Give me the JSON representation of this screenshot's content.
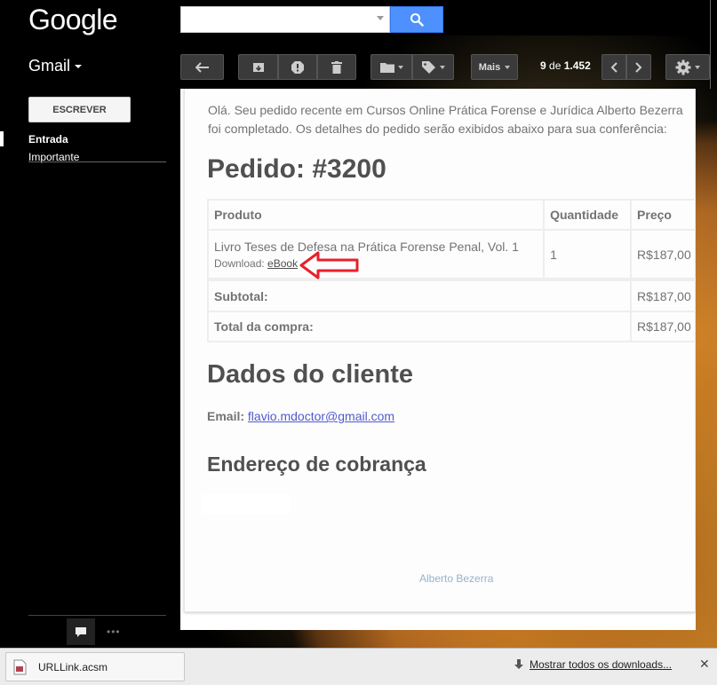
{
  "header": {
    "logo": "Google",
    "search": {
      "value": "",
      "placeholder": ""
    }
  },
  "toolbar": {
    "app_label": "Gmail",
    "more_label": "Mais",
    "pager": {
      "current": "9",
      "of_label": "de",
      "total": "1.452"
    }
  },
  "sidebar": {
    "compose_label": "ESCREVER",
    "items": [
      {
        "label": "Entrada",
        "active": true
      },
      {
        "label": "Importante",
        "active": false
      }
    ]
  },
  "email": {
    "intro": "Olá. Seu pedido recente em Cursos Online Prática Forense e Jurídica Alberto Bezerra foi completado. Os detalhes do pedido serão exibidos abaixo para sua conferência:",
    "order_title": "Pedido: #3200",
    "table": {
      "headers": [
        "Produto",
        "Quantidade",
        "Preço"
      ],
      "item": {
        "product": "Livro Teses de Defesa na Prática Forense Penal, Vol. 1",
        "download_label": "Download:",
        "download_link": "eBook",
        "quantity": "1",
        "price": "R$187,00"
      },
      "subtotal_label": "Subtotal:",
      "subtotal_value": "R$187,00",
      "total_label": "Total da compra:",
      "total_value": "R$187,00"
    },
    "customer_title": "Dados do cliente",
    "email_label": "Email:",
    "email_value": "flavio.mdoctor@gmail.com",
    "billing_title": "Endereço de cobrança",
    "footer": "Alberto Bezerra"
  },
  "download_bar": {
    "filename": "URLLink.acsm",
    "show_all": "Mostrar todos os downloads...",
    "close": "✕"
  },
  "colors": {
    "accent_blue": "#4d90fe",
    "arrow_red": "#e8202a",
    "toolbar_button": "#3a3a3a"
  }
}
